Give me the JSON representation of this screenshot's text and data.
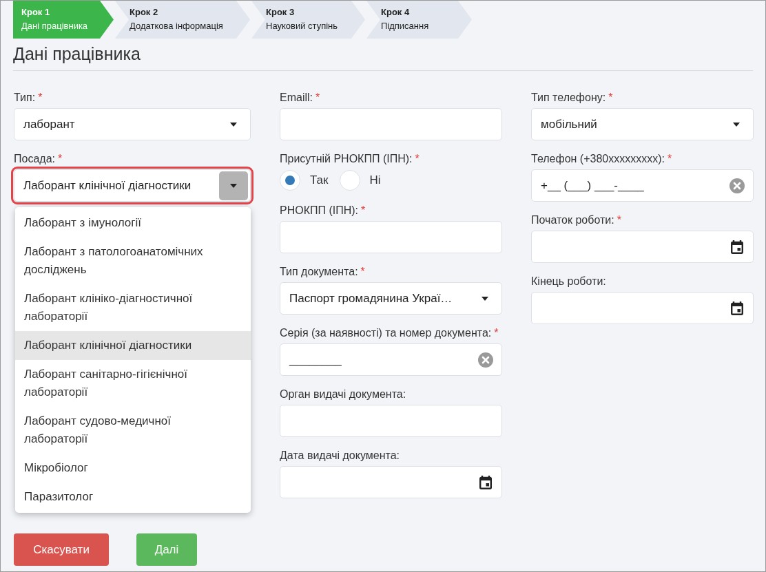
{
  "steps": [
    {
      "step": "Крок 1",
      "name": "Дані працівника",
      "selected": true
    },
    {
      "step": "Крок 2",
      "name": "Додаткова інформація",
      "selected": false
    },
    {
      "step": "Крок 3",
      "name": "Науковий ступінь",
      "selected": false
    },
    {
      "step": "Крок 4",
      "name": "Підписання",
      "selected": false
    }
  ],
  "title": "Дані працівника",
  "columns": [
    [
      {
        "kind": "select",
        "label": "Тип:",
        "required_mark": "*",
        "value": "лаборант",
        "highlighted": false,
        "open": false
      },
      {
        "kind": "select",
        "label": "Посада:",
        "required_mark": "*",
        "value": "Лаборант клінічної діагностики",
        "highlighted": true,
        "open": true,
        "options": [
          {
            "label": "Лаборант з імунології",
            "selected": false
          },
          {
            "label": "Лаборант з патологоанатомічних досліджень",
            "selected": false
          },
          {
            "label": "Лаборант клініко-діагностичної лабораторії",
            "selected": false
          },
          {
            "label": "Лаборант клінічної діагностики",
            "selected": true
          },
          {
            "label": "Лаборант санітарно-гігієнічної лабораторії",
            "selected": false
          },
          {
            "label": "Лаборант судово-медичної лабораторії",
            "selected": false
          },
          {
            "label": "Мікробіолог",
            "selected": false
          },
          {
            "label": "Паразитолог",
            "selected": false
          }
        ]
      }
    ],
    [
      {
        "kind": "text",
        "label": "Emaill:",
        "required_mark": "*"
      },
      {
        "kind": "radio",
        "label": "Присутній РНОКПП (ІПН):",
        "required_mark": "*",
        "options": [
          {
            "label": "Так",
            "selected": true
          },
          {
            "label": "Ні",
            "selected": false
          }
        ]
      },
      {
        "kind": "text",
        "label": "РНОКПП (ІПН):",
        "required_mark": "*"
      },
      {
        "kind": "select",
        "label": "Тип документа:",
        "required_mark": "*",
        "value": "Паспорт громадянина Украї…",
        "highlighted": false,
        "open": false
      },
      {
        "kind": "masked",
        "label": "Серія (за наявності) та номер документа:",
        "required_mark": "*",
        "value": "________"
      },
      {
        "kind": "text",
        "label": "Орган видачі документа:"
      },
      {
        "kind": "date",
        "label": "Дата видачі документа:"
      }
    ],
    [
      {
        "kind": "select",
        "label": "Тип телефону:",
        "required_mark": "*",
        "value": "мобільний",
        "highlighted": false,
        "open": false
      },
      {
        "kind": "masked",
        "label": "Телефон (+380xxxxxxxxx):",
        "required_mark": "*",
        "value": "+__ (___) ___-____"
      },
      {
        "kind": "date",
        "label": "Початок роботи:",
        "required_mark": "*"
      },
      {
        "kind": "date",
        "label": "Кінець роботи:"
      }
    ]
  ],
  "buttons": [
    {
      "label": "Скасувати",
      "kind": "cancel"
    },
    {
      "label": "Далі",
      "kind": "next"
    }
  ]
}
